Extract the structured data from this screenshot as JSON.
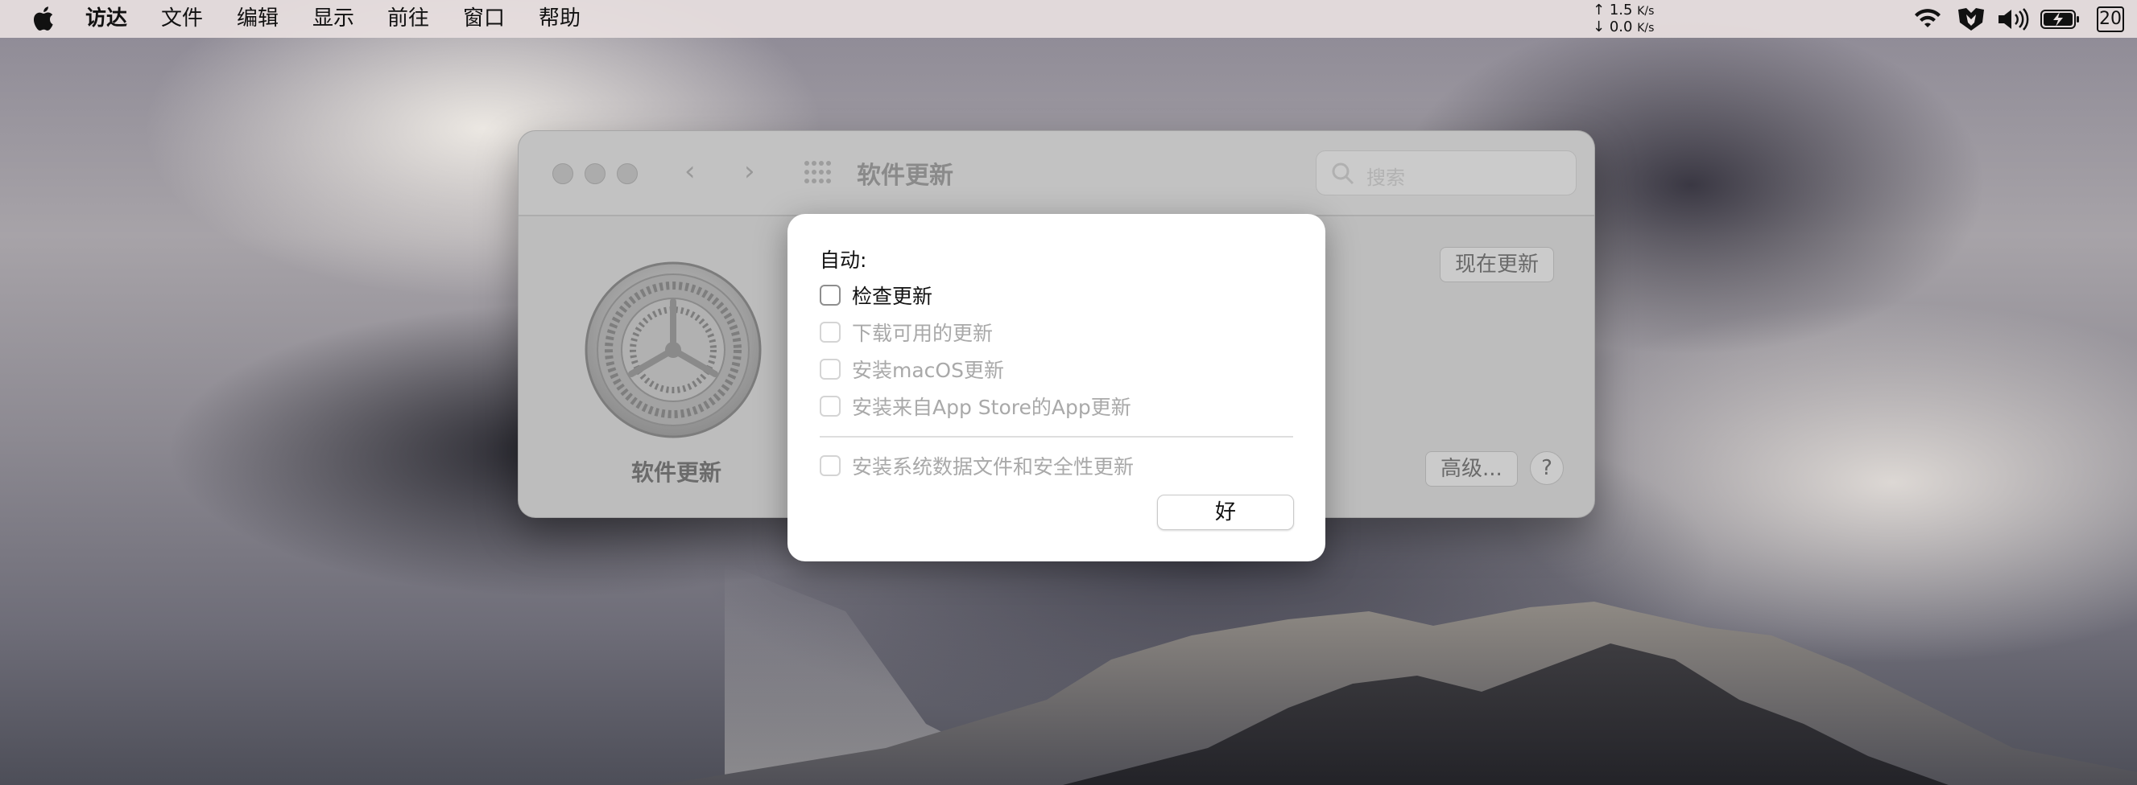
{
  "menubar": {
    "items": [
      "访达",
      "文件",
      "编辑",
      "显示",
      "前往",
      "窗口",
      "帮助"
    ],
    "net_up": "1.5",
    "net_down": "0.0",
    "net_unit": "K/s",
    "date": "20"
  },
  "window": {
    "title": "软件更新",
    "search_placeholder": "搜索",
    "pane_label": "软件更新",
    "update_now": "现在更新",
    "advanced": "高级...",
    "help": "?"
  },
  "sheet": {
    "title": "自动:",
    "options": [
      {
        "label": "检查更新",
        "enabled": true,
        "checked": false
      },
      {
        "label": "下载可用的更新",
        "enabled": false,
        "checked": false
      },
      {
        "label": "安装macOS更新",
        "enabled": false,
        "checked": false
      },
      {
        "label": "安装来自App Store的App更新",
        "enabled": false,
        "checked": false
      },
      {
        "label": "安装系统数据文件和安全性更新",
        "enabled": false,
        "checked": false
      }
    ],
    "ok": "好"
  }
}
